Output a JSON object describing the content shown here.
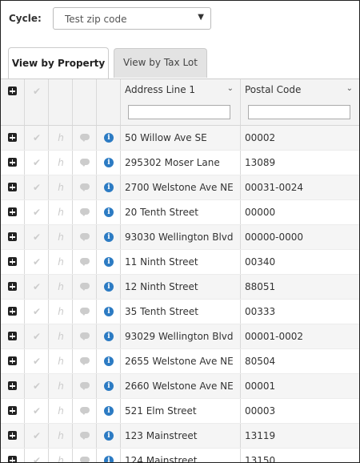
{
  "cycle": {
    "label": "Cycle:",
    "selected": "Test zip code"
  },
  "tabs": [
    {
      "label": "View by Property",
      "active": true
    },
    {
      "label": "View by Tax Lot",
      "active": false
    }
  ],
  "columns": [
    {
      "title": "Address Line 1",
      "filter_value": ""
    },
    {
      "title": "Postal Code",
      "filter_value": ""
    }
  ],
  "rows": [
    {
      "address": "50 Willow Ave SE",
      "postal": "00002"
    },
    {
      "address": "295302 Moser Lane",
      "postal": "13089"
    },
    {
      "address": "2700 Welstone Ave NE",
      "postal": "00031-0024"
    },
    {
      "address": "20 Tenth Street",
      "postal": "00000"
    },
    {
      "address": "93030 Wellington Blvd",
      "postal": "00000-0000"
    },
    {
      "address": "11 Ninth Street",
      "postal": "00340"
    },
    {
      "address": "12 Ninth Street",
      "postal": "88051"
    },
    {
      "address": "35 Tenth Street",
      "postal": "00333"
    },
    {
      "address": "93029 Wellington Blvd",
      "postal": "00001-0002"
    },
    {
      "address": "2655 Welstone Ave NE",
      "postal": "80504"
    },
    {
      "address": "2660 Welstone Ave NE",
      "postal": "00001"
    },
    {
      "address": "521 Elm Street",
      "postal": "00003"
    },
    {
      "address": "123 Mainstreet",
      "postal": "13119"
    },
    {
      "address": "124 Mainstreet",
      "postal": "13150"
    }
  ],
  "icons": {
    "expand": "plus-square-icon",
    "select": "check-icon",
    "history": "history-icon",
    "notes": "comment-icon",
    "info": "info-circle-icon",
    "info_color": "#2c7bc3"
  }
}
